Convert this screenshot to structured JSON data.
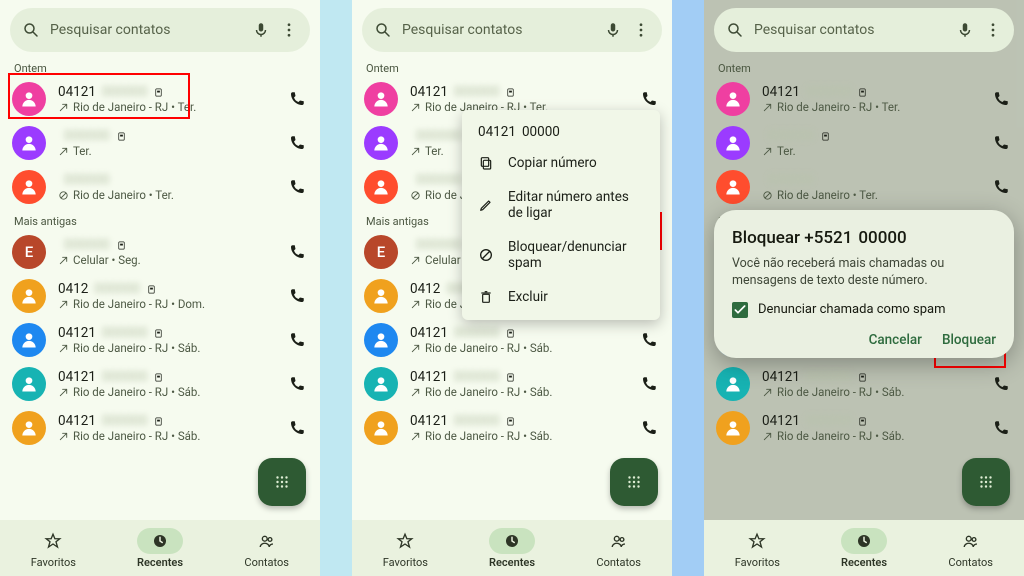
{
  "search": {
    "placeholder": "Pesquisar contatos"
  },
  "sections": {
    "yesterday": "Ontem",
    "older": "Mais antigas"
  },
  "nav": {
    "fav": "Favoritos",
    "recent": "Recentes",
    "contacts": "Contatos"
  },
  "avatar_colors": {
    "pink": "#ef3fa1",
    "purple": "#9b3bff",
    "orangeRed": "#ff4d2e",
    "brown": "#b8472a",
    "amber": "#f0a11e",
    "blue": "#1e88f0",
    "teal": "#17b3b3"
  },
  "calls": [
    {
      "id": "c1",
      "avatar": "pink",
      "type": "icon",
      "num": "04121",
      "tail": "…",
      "sim": true,
      "sub_pre": "↗ ",
      "sub": "Rio de Janeiro - RJ • Ter."
    },
    {
      "id": "c2",
      "avatar": "purple",
      "type": "icon",
      "num": "",
      "tail": "…",
      "sim": true,
      "sub_pre": "↗ ",
      "sub": "Ter.",
      "blocked": false
    },
    {
      "id": "c3",
      "avatar": "orangeRed",
      "type": "icon",
      "num": "",
      "tail": "…",
      "sim": false,
      "sub_pre": "",
      "sub": "Rio de Janeiro • Ter.",
      "blocked": true
    },
    {
      "id": "c4",
      "avatar": "brown",
      "type": "letter",
      "letter": "E",
      "num": "",
      "tail": "…",
      "sim": true,
      "sub_pre": "↗ ",
      "sub": "Celular • Seg."
    },
    {
      "id": "c5",
      "avatar": "amber",
      "type": "icon",
      "num": "0412",
      "tail": "…",
      "sim": true,
      "sub_pre": "↗ ",
      "sub": "Rio de Janeiro - RJ • Dom."
    },
    {
      "id": "c6",
      "avatar": "blue",
      "type": "icon",
      "num": "04121",
      "tail": "…",
      "sim": true,
      "sub_pre": "↗ ",
      "sub": "Rio de Janeiro - RJ • Sáb."
    },
    {
      "id": "c7",
      "avatar": "teal",
      "type": "icon",
      "num": "04121",
      "tail": "…",
      "sim": true,
      "sub_pre": "↗ ",
      "sub": "Rio de Janeiro - RJ • Sáb."
    },
    {
      "id": "c8",
      "avatar": "amber",
      "type": "icon",
      "num": "04121",
      "tail": "…",
      "sim": true,
      "sub_pre": "↗ ",
      "sub": "Rio de Janeiro - RJ • Sáb."
    }
  ],
  "context_menu": {
    "title_num": "04121",
    "title_tail": "…",
    "copy": "Copiar número",
    "edit": "Editar número antes de ligar",
    "block": "Bloquear/denunciar spam",
    "delete": "Excluir"
  },
  "dialog": {
    "title_pre": "Bloquear +5521",
    "title_tail": "…",
    "body": "Você não receberá mais chamadas ou mensagens de texto deste número.",
    "checkbox": "Denunciar chamada como spam",
    "cancel": "Cancelar",
    "confirm": "Bloquear"
  }
}
